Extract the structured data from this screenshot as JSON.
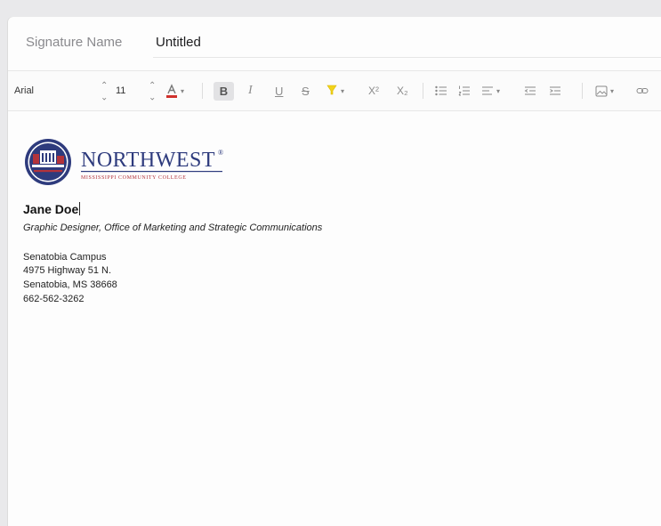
{
  "signature": {
    "name_label": "Signature Name",
    "name_value": "Untitled"
  },
  "toolbar": {
    "font_name": "Arial",
    "font_size": "11",
    "bold": "B",
    "italic": "I",
    "underline": "U",
    "strikethrough": "S",
    "superscript": "X²",
    "subscript": "X₂"
  },
  "logo": {
    "wordmark": "NORTHWEST",
    "registered": "®",
    "tagline": "MISSISSIPPI COMMUNITY COLLEGE"
  },
  "body": {
    "name": "Jane Doe",
    "title": "Graphic Designer, Office of Marketing and Strategic Communications",
    "campus": "Senatobia Campus",
    "street": "4975 Highway 51 N.",
    "city": "Senatobia, MS 38668",
    "phone": "662-562-3262"
  },
  "colors": {
    "logo_navy": "#2e3b7d",
    "logo_red": "#b2333b",
    "font_color_bar": "#d0312d",
    "highlight": "#f2d31b"
  }
}
